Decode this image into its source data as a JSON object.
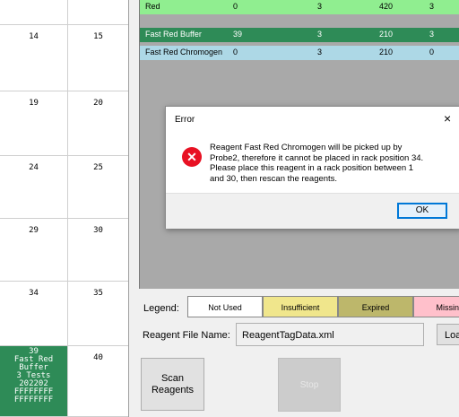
{
  "rack": {
    "cells": [
      {
        "col1": "14",
        "col2": "15"
      },
      {
        "col1": "19",
        "col2": "20"
      },
      {
        "col1": "24",
        "col2": "25"
      },
      {
        "col1": "29",
        "col2": "30"
      },
      {
        "col1": "34",
        "col2": "35"
      }
    ],
    "filled": {
      "lines": [
        "39",
        "Fast Red",
        "Buffer",
        "3 Tests",
        "202202",
        "FFFFFFFF",
        "FFFFFFFF"
      ],
      "col2": "40"
    }
  },
  "table": {
    "rows": [
      {
        "name": "Red",
        "c1": "0",
        "c2": "3",
        "c3": "420",
        "c4": "3",
        "bg": "#90ee90",
        "fg": "#000000"
      },
      {
        "name": "Fast Red Buffer",
        "c1": "39",
        "c2": "3",
        "c3": "210",
        "c4": "3",
        "bg": "#2e8b57",
        "fg": "#ffffff"
      },
      {
        "name": "Fast Red Chromogen",
        "c1": "0",
        "c2": "3",
        "c3": "210",
        "c4": "0",
        "bg": "#add8e6",
        "fg": "#000000"
      }
    ]
  },
  "dialog": {
    "title": "Error",
    "close": "×",
    "icon": "error-x-icon",
    "message": "Reagent  Fast Red Chromogen will be picked up by Probe2, therefore it cannot be placed in rack position 34. Please place this reagent in a rack position between 1 and 30, then rescan the reagents.",
    "ok": "OK"
  },
  "legend": {
    "label": "Legend:",
    "items": [
      {
        "text": "Not Used",
        "color": "#ffffff"
      },
      {
        "text": "Insufficient",
        "color": "#f0e68c"
      },
      {
        "text": "Expired",
        "color": "#bdb76b"
      },
      {
        "text": "Missin",
        "color": "#ffc0cb"
      }
    ]
  },
  "file": {
    "label": "Reagent File Name:",
    "value": "ReagentTagData.xml",
    "load": "Loa"
  },
  "buttons": {
    "scan_line1": "Scan",
    "scan_line2": "Reagents",
    "stop": "Stop"
  }
}
